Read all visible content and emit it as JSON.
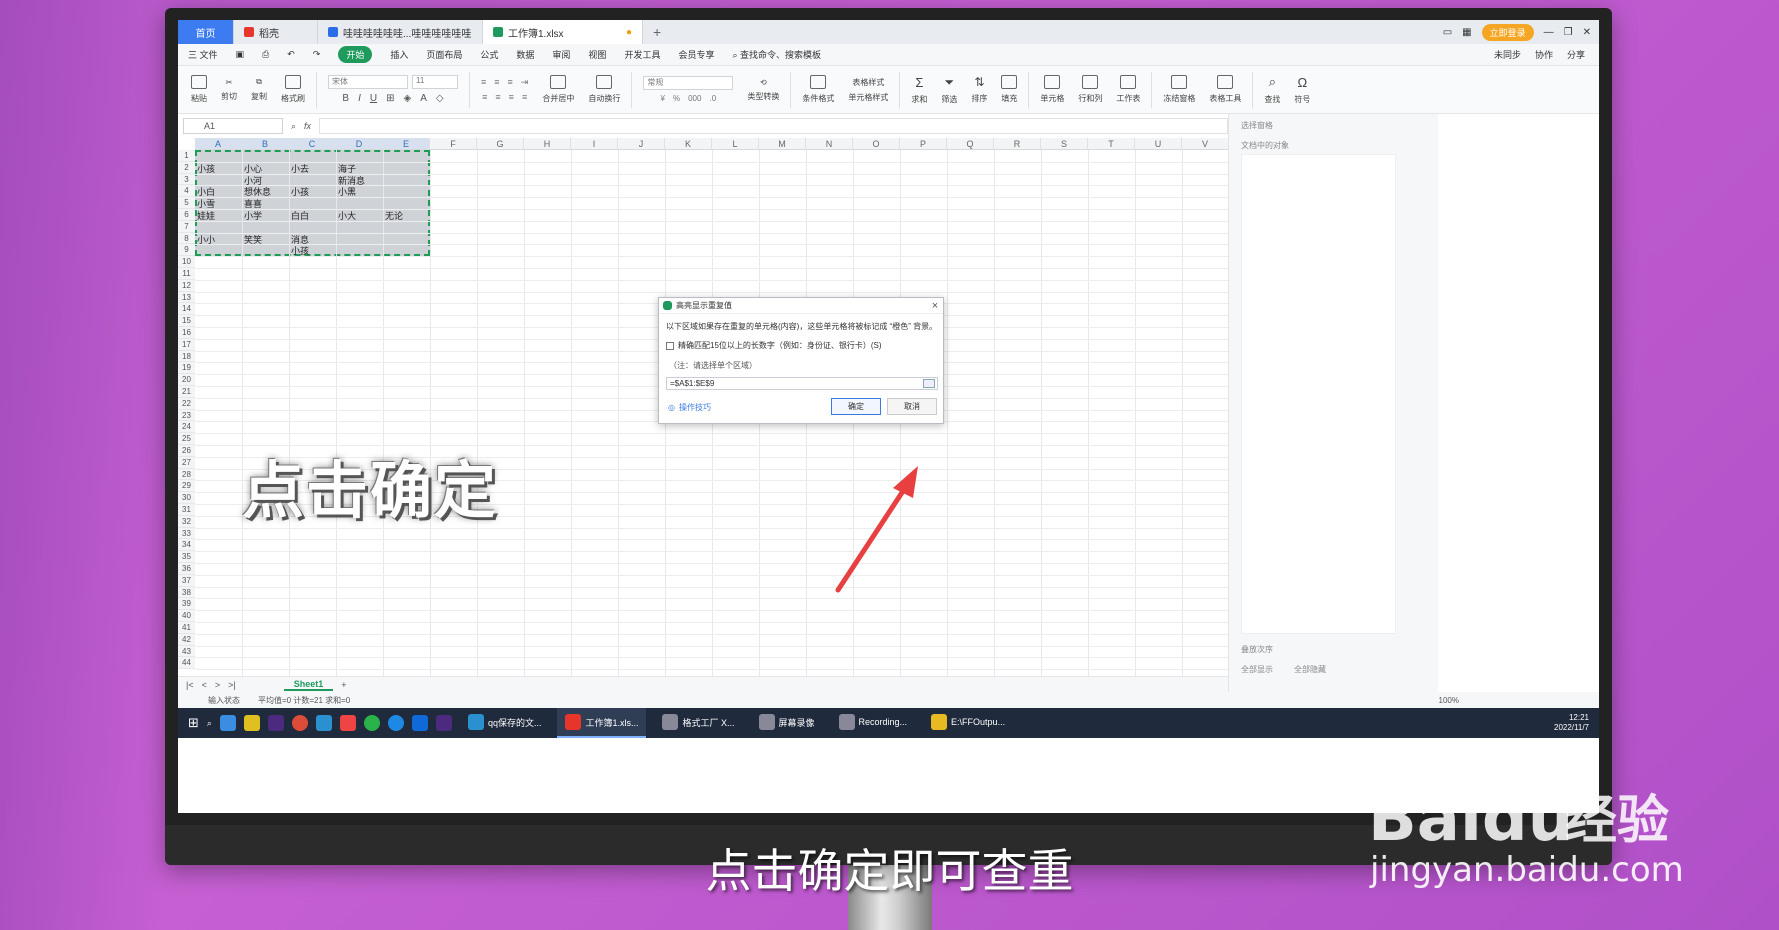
{
  "titlebar": {
    "home_tab": "首页",
    "tabs": [
      {
        "label": "稻壳",
        "color": "#e8352b"
      },
      {
        "label": "哇哇哇哇哇哇...哇哇哇哇哇哇",
        "color": "#2b6de8"
      },
      {
        "label": "工作簿1.xlsx",
        "color": "#1e9a5c"
      }
    ],
    "login_label": "立即登录"
  },
  "menubar": {
    "file": "三 文件",
    "items": [
      "开始",
      "插入",
      "页面布局",
      "公式",
      "数据",
      "审阅",
      "视图",
      "开发工具",
      "会员专享"
    ],
    "search_placeholder": "查找命令、搜索模板",
    "right": [
      "未同步",
      "协作",
      "分享"
    ]
  },
  "ribbon": {
    "paste": "粘贴",
    "cut": "剪切",
    "copy": "复制",
    "format_painter": "格式刷",
    "font_name": "宋体",
    "font_size": "11",
    "merge": "合并居中",
    "wrap": "自动换行",
    "number_format": "常规",
    "type_convert": "类型转换",
    "cond_format": "条件格式",
    "table_style": "表格样式",
    "cell_style": "单元格样式",
    "sum": "求和",
    "filter": "筛选",
    "sort": "排序",
    "fill": "填充",
    "cell": "单元格",
    "rowcol": "行和列",
    "sheet": "工作表",
    "freeze": "冻结窗格",
    "table_tools": "表格工具",
    "find": "查找",
    "symbol": "符号"
  },
  "formulabar": {
    "name_box": "A1",
    "fx": "fx"
  },
  "columns": [
    "A",
    "B",
    "C",
    "D",
    "E",
    "F",
    "G",
    "H",
    "I",
    "J",
    "K",
    "L",
    "M",
    "N",
    "O",
    "P",
    "Q",
    "R",
    "S",
    "T",
    "U",
    "V"
  ],
  "rows_count": 44,
  "cells": [
    {
      "row": 2,
      "col": 0,
      "text": "小孩"
    },
    {
      "row": 2,
      "col": 1,
      "text": "小心"
    },
    {
      "row": 2,
      "col": 2,
      "text": "小去"
    },
    {
      "row": 2,
      "col": 3,
      "text": "海子"
    },
    {
      "row": 3,
      "col": 1,
      "text": "小河"
    },
    {
      "row": 3,
      "col": 3,
      "text": "新消息"
    },
    {
      "row": 4,
      "col": 0,
      "text": "小白"
    },
    {
      "row": 4,
      "col": 1,
      "text": "想休息"
    },
    {
      "row": 4,
      "col": 2,
      "text": "小孩"
    },
    {
      "row": 4,
      "col": 3,
      "text": "小黑"
    },
    {
      "row": 5,
      "col": 0,
      "text": "小雪"
    },
    {
      "row": 5,
      "col": 1,
      "text": "喜喜"
    },
    {
      "row": 6,
      "col": 0,
      "text": "娃娃"
    },
    {
      "row": 6,
      "col": 1,
      "text": "小学"
    },
    {
      "row": 6,
      "col": 2,
      "text": "白白"
    },
    {
      "row": 6,
      "col": 3,
      "text": "小大"
    },
    {
      "row": 6,
      "col": 4,
      "text": "无论"
    },
    {
      "row": 8,
      "col": 0,
      "text": "小小"
    },
    {
      "row": 8,
      "col": 1,
      "text": "笑笑"
    },
    {
      "row": 8,
      "col": 2,
      "text": "消息"
    },
    {
      "row": 9,
      "col": 2,
      "text": "小孩"
    }
  ],
  "sheetbar": {
    "sheet_name": "Sheet1"
  },
  "statusbar": {
    "mode": "输入状态",
    "stats": "平均值=0  计数=21  求和=0",
    "zoom": "100%"
  },
  "right_panel": {
    "title": "选择窗格",
    "subtitle": "文档中的对象",
    "order": "叠放次序",
    "show_all": "全部显示",
    "hide_all": "全部隐藏"
  },
  "dialog": {
    "title": "高亮显示重复值",
    "description": "以下区域如果存在重复的单元格(内容)，这些单元格将被标记成 “橙色” 背景。",
    "checkbox": "精确匹配15位以上的长数字（例如：身份证、银行卡）(S)",
    "note": "（注：请选择单个区域）",
    "range": "=$A$1:$E$9",
    "tips": "操作技巧",
    "ok": "确定",
    "cancel": "取消"
  },
  "taskbar": {
    "apps": [
      "qq保存的文...",
      "工作簿1.xls...",
      "格式工厂 X...",
      "屏幕录像",
      "Recording...",
      "E:\\FFOutpu..."
    ],
    "time": "12:21",
    "date": "2022/11/7"
  },
  "overlay": {
    "caption": "点击确定",
    "subtitle": "点击确定即可查重"
  },
  "watermark": {
    "brand": "Baidu",
    "jingyan": "经验",
    "url": "jingyan.baidu.com"
  }
}
